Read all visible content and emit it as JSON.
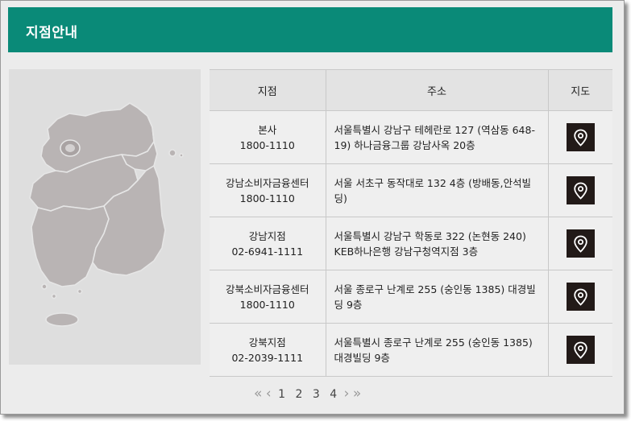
{
  "header": {
    "title": "지점안내"
  },
  "map_panel": {
    "image": "korea-map"
  },
  "table": {
    "columns": [
      "지점",
      "주소",
      "지도"
    ],
    "rows": [
      {
        "name": "본사",
        "phone": "1800-1110",
        "address": "서울특별시 강남구 테헤란로 127 (역삼동 648-19) 하나금융그룹 강남사옥 20층",
        "map_icon": "map-pin-icon"
      },
      {
        "name": "강남소비자금융센터",
        "phone": "1800-1110",
        "address": "서울 서초구 동작대로 132 4층 (방배동,안석빌딩)",
        "map_icon": "map-pin-icon"
      },
      {
        "name": "강남지점",
        "phone": "02-6941-1111",
        "address": "서울특별시 강남구 학동로 322 (논현동 240) KEB하나은행 강남구청역지점 3층",
        "map_icon": "map-pin-icon"
      },
      {
        "name": "강북소비자금융센터",
        "phone": "1800-1110",
        "address": "서울 종로구 난계로 255 (숭인동 1385) 대경빌딩 9층",
        "map_icon": "map-pin-icon"
      },
      {
        "name": "강북지점",
        "phone": "02-2039-1111",
        "address": "서울특별시 종로구 난계로 255 (숭인동 1385) 대경빌딩 9층",
        "map_icon": "map-pin-icon"
      }
    ]
  },
  "pagination": {
    "first": "«",
    "prev": "‹",
    "pages": [
      "1",
      "2",
      "3",
      "4"
    ],
    "next": "›",
    "last": "»"
  }
}
